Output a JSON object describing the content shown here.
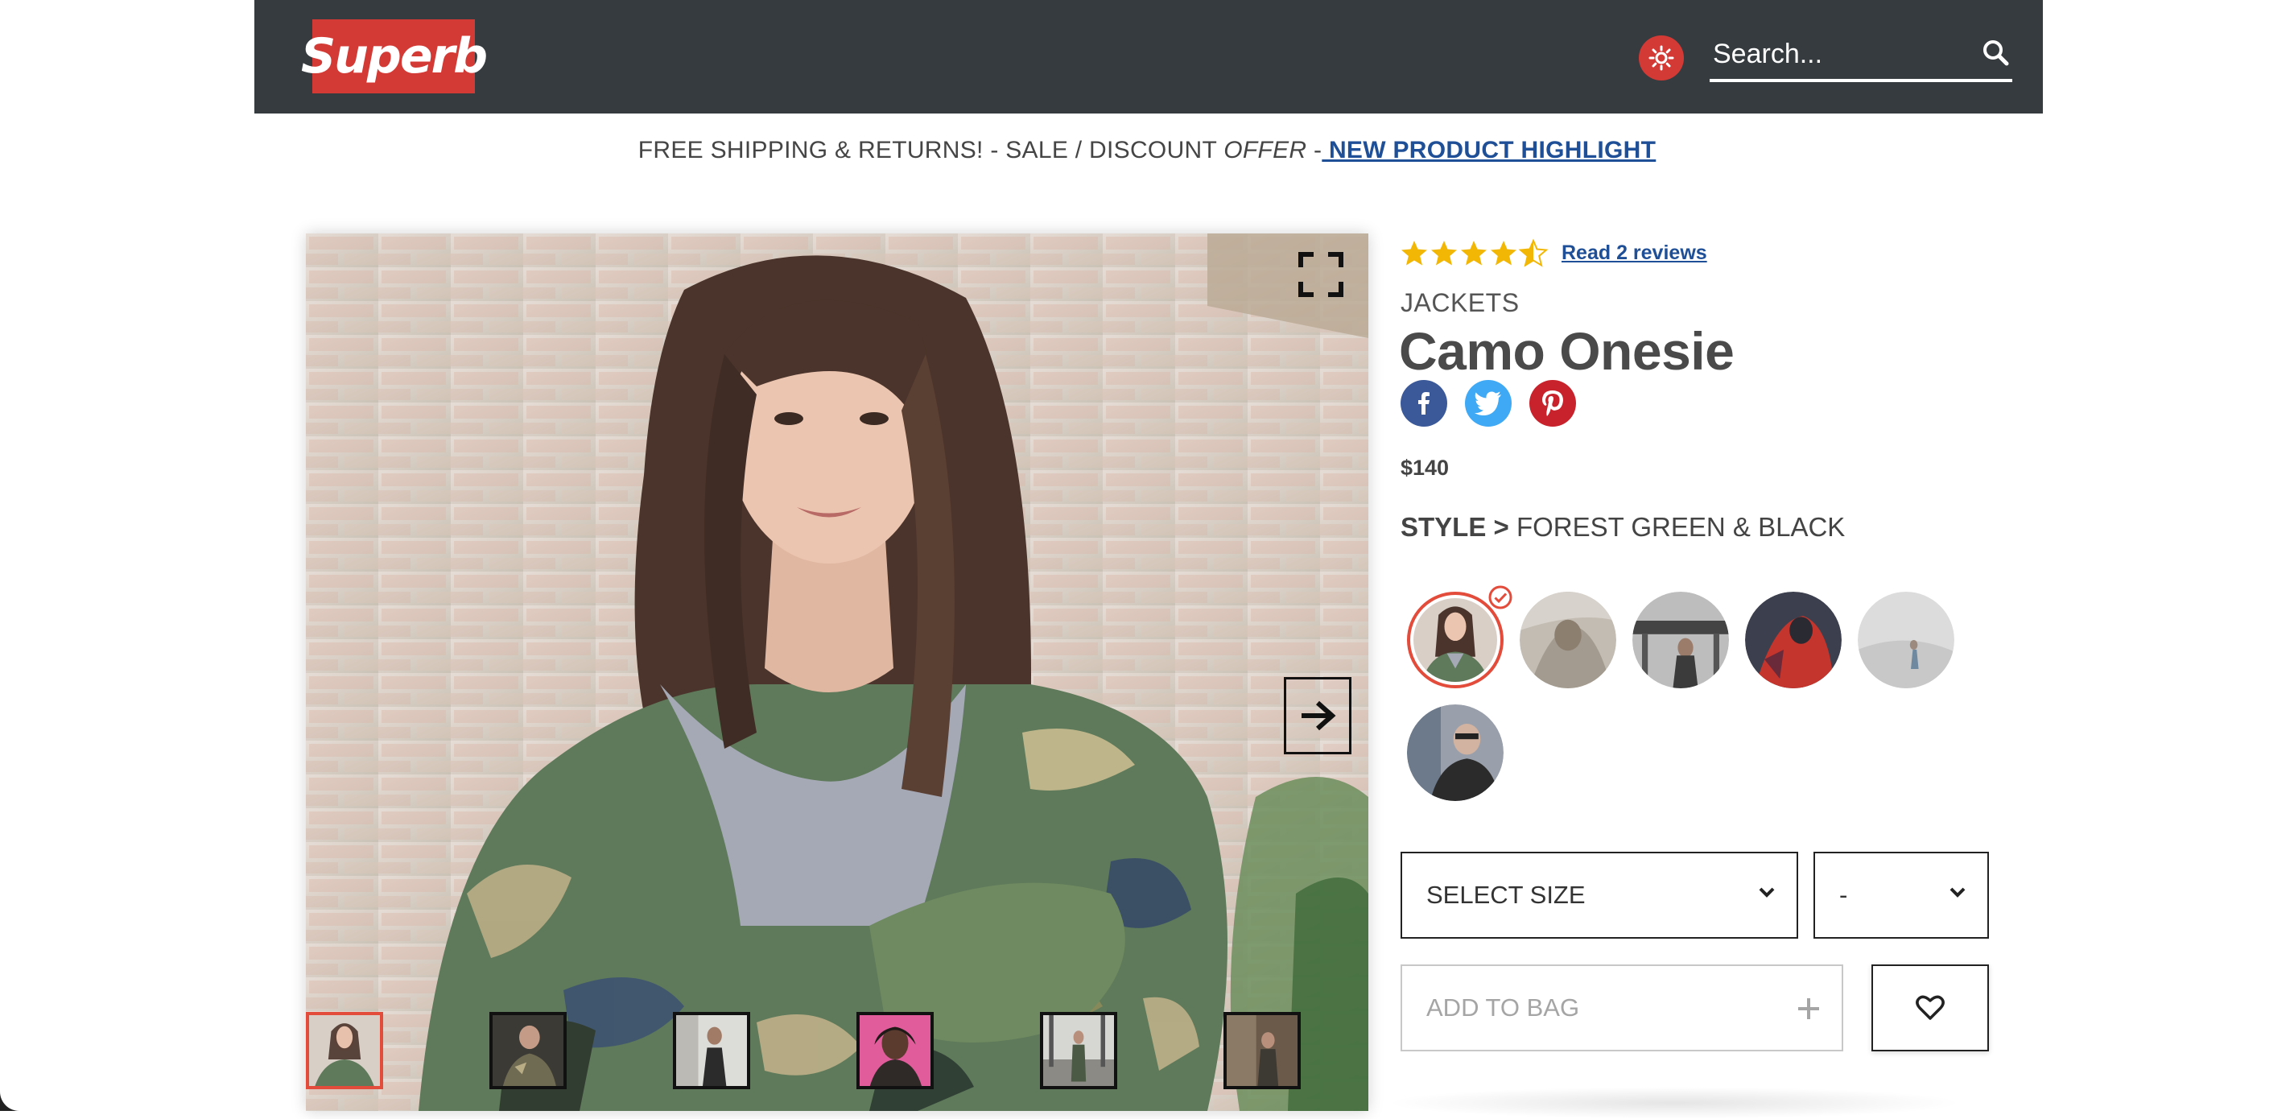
{
  "header": {
    "logo_text": "Superb",
    "search_placeholder": "Search...",
    "accent_color": "#d33a35",
    "bar_color": "#363b40"
  },
  "promo": {
    "text": "FREE SHIPPING & RETURNS! - SALE / DISCOUNT ",
    "offer": "OFFER",
    "dash": " -",
    "link": " NEW PRODUCT HIGHLIGHT"
  },
  "product": {
    "rating": 4.5,
    "reviews_link": "Read 2 reviews",
    "category": "JACKETS",
    "title": "Camo Onesie",
    "price": "$140",
    "style_label": "STYLE >",
    "style_value": " FOREST GREEN & BLACK",
    "social": [
      "facebook",
      "twitter",
      "pinterest"
    ],
    "size_select": "SELECT SIZE",
    "qty_select": "-",
    "add_to_bag": "ADD TO BAG",
    "swatch_count": 6,
    "selected_swatch": 1
  },
  "gallery": {
    "thumbnail_count": 6,
    "active_thumbnail": 1
  }
}
